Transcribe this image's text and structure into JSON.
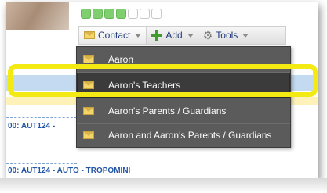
{
  "toolbar": {
    "contact_label": "Contact",
    "add_label": "Add",
    "tools_label": "Tools"
  },
  "status_dots": {
    "filled": 4,
    "total": 7
  },
  "menu": {
    "items": [
      {
        "label": "Aaron"
      },
      {
        "label": "Aaron's Teachers",
        "selected": true
      },
      {
        "label": "Aaron's Parents / Guardians"
      },
      {
        "label": "Aaron and Aaron's Parents / Guardians"
      }
    ]
  },
  "background_rows": {
    "row1": "00: AUT124 -",
    "row2": "00: AUT124 - AUTO - TROPOMINI"
  },
  "colors": {
    "highlight": "#f3ea14",
    "menu_bg": "#5b5b5b",
    "status_green": "#7fcf6e"
  }
}
